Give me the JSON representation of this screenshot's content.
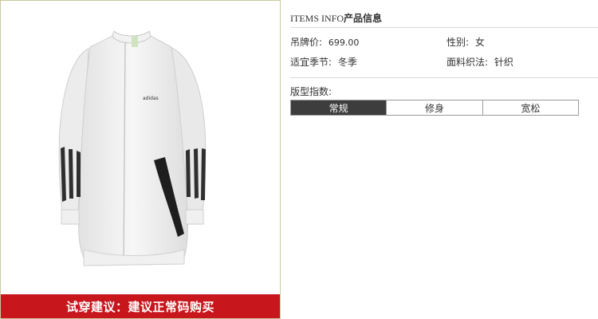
{
  "product_image": {
    "logo_text": "adidas"
  },
  "fit_tip": "试穿建议：建议正常码购买",
  "info": {
    "title_latin": "ITEMS INFO",
    "title_cn": "产品信息",
    "fields": [
      {
        "label": "吊牌价:",
        "value": "699.00"
      },
      {
        "label": "性别:",
        "value": "女"
      },
      {
        "label": "适宜季节:",
        "value": "冬季"
      },
      {
        "label": "面料织法:",
        "value": "针织"
      }
    ],
    "fit_label": "版型指数:",
    "fit_options": [
      {
        "label": "常规",
        "selected": true
      },
      {
        "label": "修身",
        "selected": false
      },
      {
        "label": "宽松",
        "selected": false
      }
    ]
  },
  "colors": {
    "tip_bar": "#c8161d",
    "selected_segment": "#3d3d3d",
    "image_border": "#c9c9a0"
  }
}
